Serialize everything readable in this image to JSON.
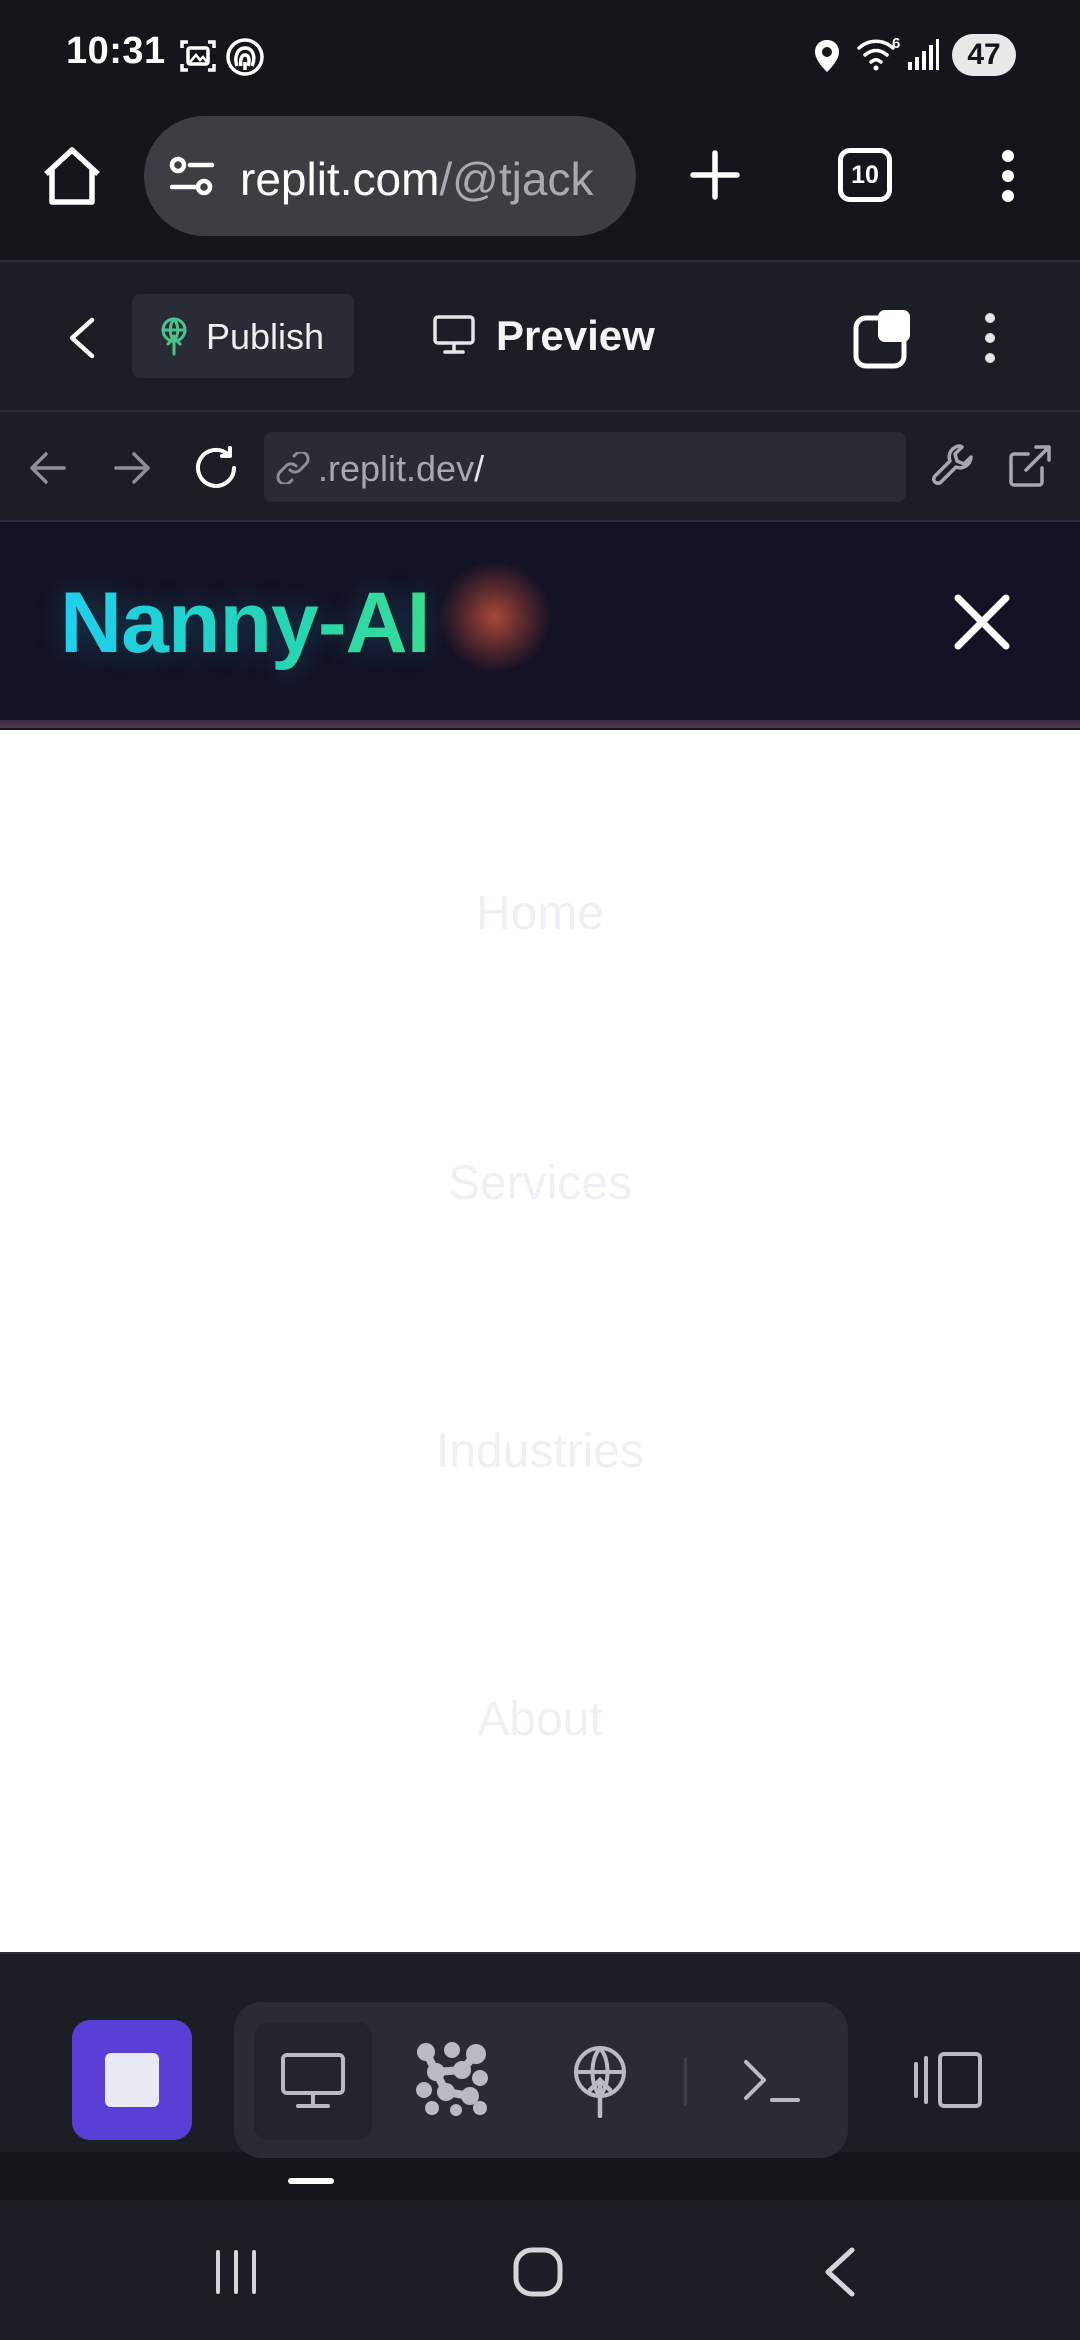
{
  "status_bar": {
    "time": "10:31",
    "battery": "47",
    "network": "6",
    "icons": [
      "screenshot-icon",
      "hotspot-icon",
      "location-icon",
      "wifi-icon",
      "signal-icon"
    ]
  },
  "browser": {
    "url_host": "replit.com",
    "url_path": "/@tjack",
    "tab_count": "10",
    "icons": [
      "home-icon",
      "site-info-icon",
      "new-tab-icon",
      "tab-switcher-icon",
      "more-icon"
    ]
  },
  "replit": {
    "publish_label": "Publish",
    "preview_label": "Preview",
    "webview_url": ".replit.dev",
    "webview_url_slash": "/"
  },
  "site": {
    "logo": "Nanny-AI",
    "menu": [
      {
        "label": "Home"
      },
      {
        "label": "Services"
      },
      {
        "label": "Industries"
      },
      {
        "label": "About"
      }
    ]
  },
  "dock": {
    "items": [
      "stop",
      "preview",
      "agent",
      "deployments",
      "shell",
      "panels"
    ]
  },
  "colors": {
    "stop_button": "#5a3fd6",
    "logo_gradient_start": "#1fd0f0",
    "logo_gradient_end": "#3be08c",
    "publish_icon": "#4cc38a"
  }
}
